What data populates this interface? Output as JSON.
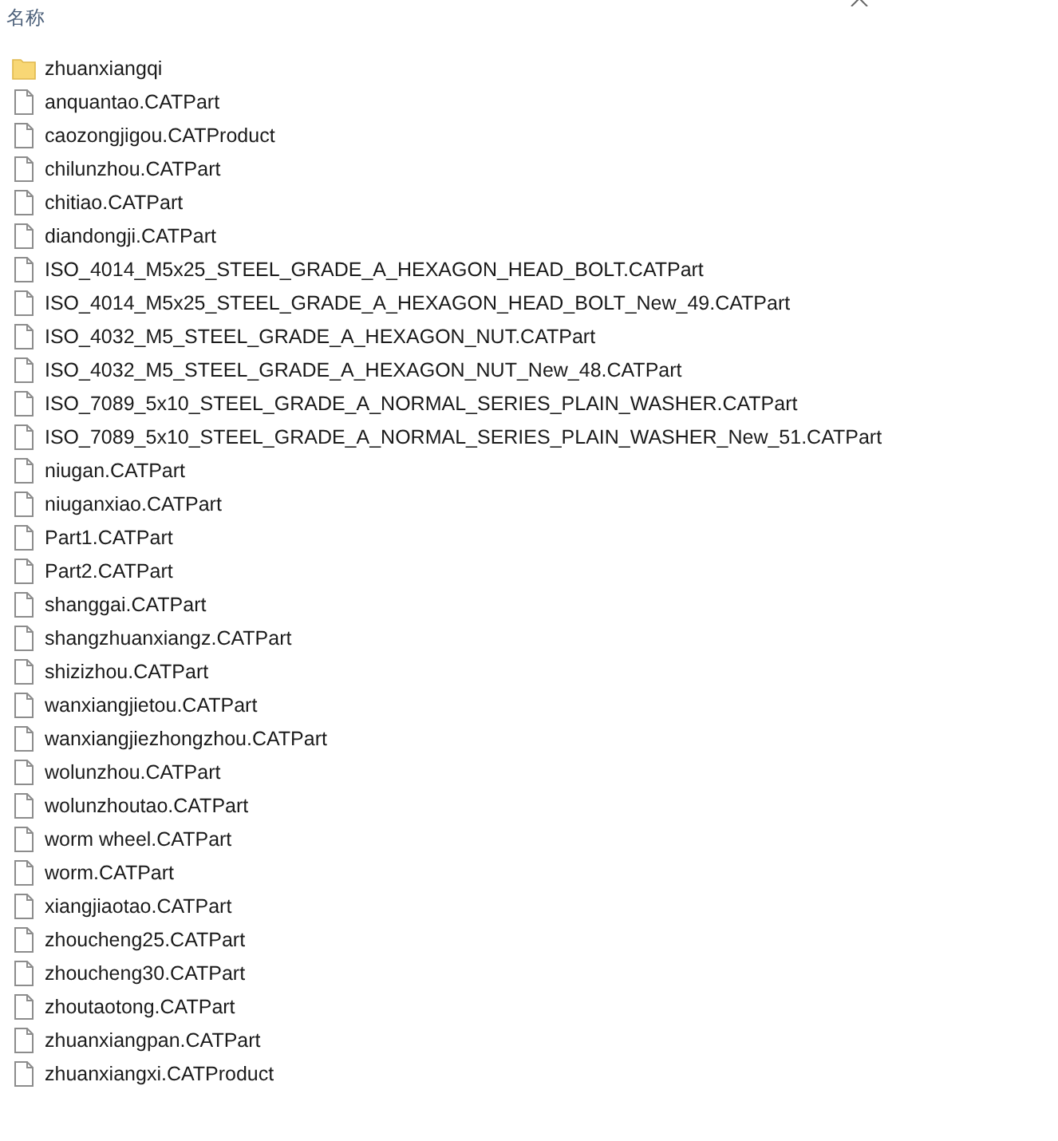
{
  "header": {
    "label": "名称"
  },
  "files": [
    {
      "name": "zhuanxiangqi",
      "kind": "folder"
    },
    {
      "name": "anquantao.CATPart",
      "kind": "file"
    },
    {
      "name": "caozongjigou.CATProduct",
      "kind": "file"
    },
    {
      "name": "chilunzhou.CATPart",
      "kind": "file"
    },
    {
      "name": "chitiao.CATPart",
      "kind": "file"
    },
    {
      "name": "diandongji.CATPart",
      "kind": "file"
    },
    {
      "name": "ISO_4014_M5x25_STEEL_GRADE_A_HEXAGON_HEAD_BOLT.CATPart",
      "kind": "file"
    },
    {
      "name": "ISO_4014_M5x25_STEEL_GRADE_A_HEXAGON_HEAD_BOLT_New_49.CATPart",
      "kind": "file"
    },
    {
      "name": "ISO_4032_M5_STEEL_GRADE_A_HEXAGON_NUT.CATPart",
      "kind": "file"
    },
    {
      "name": "ISO_4032_M5_STEEL_GRADE_A_HEXAGON_NUT_New_48.CATPart",
      "kind": "file"
    },
    {
      "name": "ISO_7089_5x10_STEEL_GRADE_A_NORMAL_SERIES_PLAIN_WASHER.CATPart",
      "kind": "file"
    },
    {
      "name": "ISO_7089_5x10_STEEL_GRADE_A_NORMAL_SERIES_PLAIN_WASHER_New_51.CATPart",
      "kind": "file"
    },
    {
      "name": "niugan.CATPart",
      "kind": "file"
    },
    {
      "name": "niuganxiao.CATPart",
      "kind": "file"
    },
    {
      "name": "Part1.CATPart",
      "kind": "file"
    },
    {
      "name": "Part2.CATPart",
      "kind": "file"
    },
    {
      "name": "shanggai.CATPart",
      "kind": "file"
    },
    {
      "name": "shangzhuanxiangz.CATPart",
      "kind": "file"
    },
    {
      "name": "shizizhou.CATPart",
      "kind": "file"
    },
    {
      "name": "wanxiangjietou.CATPart",
      "kind": "file"
    },
    {
      "name": "wanxiangjiezhongzhou.CATPart",
      "kind": "file"
    },
    {
      "name": "wolunzhou.CATPart",
      "kind": "file"
    },
    {
      "name": "wolunzhoutao.CATPart",
      "kind": "file"
    },
    {
      "name": "worm wheel.CATPart",
      "kind": "file"
    },
    {
      "name": "worm.CATPart",
      "kind": "file"
    },
    {
      "name": "xiangjiaotao.CATPart",
      "kind": "file"
    },
    {
      "name": "zhoucheng25.CATPart",
      "kind": "file"
    },
    {
      "name": "zhoucheng30.CATPart",
      "kind": "file"
    },
    {
      "name": "zhoutaotong.CATPart",
      "kind": "file"
    },
    {
      "name": "zhuanxiangpan.CATPart",
      "kind": "file"
    },
    {
      "name": "zhuanxiangxi.CATProduct",
      "kind": "file"
    }
  ]
}
